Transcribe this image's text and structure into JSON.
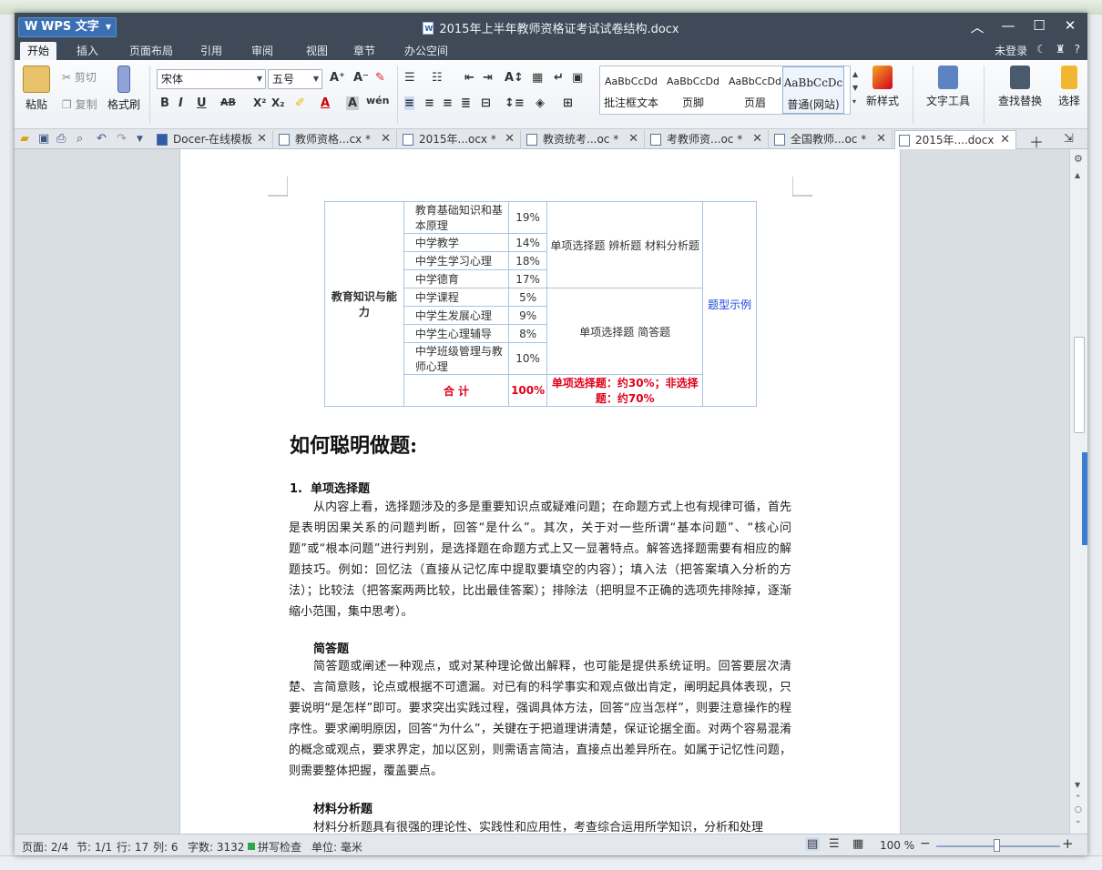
{
  "app": {
    "logo_text": "WPS 文字",
    "doc_title": "2015年上半年教师资格证考试试卷结构.docx"
  },
  "menu": {
    "tabs": [
      "开始",
      "插入",
      "页面布局",
      "引用",
      "审阅",
      "视图",
      "章节",
      "办公空间"
    ],
    "active": "开始",
    "login": "未登录",
    "help": "?"
  },
  "ribbon": {
    "paste": "粘贴",
    "cut": "剪切",
    "copy": "复制",
    "format_painter": "格式刷",
    "font": "宋体",
    "size": "五号",
    "styles": [
      {
        "preview": "AaBbCcDd",
        "name": "批注框文本"
      },
      {
        "preview": "AaBbCcDd",
        "name": "页脚"
      },
      {
        "preview": "AaBbCcDd",
        "name": "页眉"
      },
      {
        "preview": "AaBbCcDc",
        "name": "普通(网站)"
      }
    ],
    "new_style": "新样式",
    "text_tools": "文字工具",
    "find_replace": "查找替换",
    "select": "选择"
  },
  "doc_tabs": [
    {
      "label": "Docer-在线模板"
    },
    {
      "label": "教师资格...cx *"
    },
    {
      "label": "2015年...ocx *"
    },
    {
      "label": "教资统考...oc *"
    },
    {
      "label": "考教师资...oc *"
    },
    {
      "label": "全国教师...oc *"
    },
    {
      "label": "2015年....docx"
    }
  ],
  "table": {
    "category": "教育知识与能力",
    "rows": [
      {
        "subject": "教育基础知识和基本原理",
        "pct": "19%"
      },
      {
        "subject": "中学教学",
        "pct": "14%"
      },
      {
        "subject": "中学生学习心理",
        "pct": "18%"
      },
      {
        "subject": "中学德育",
        "pct": "17%"
      },
      {
        "subject": "中学课程",
        "pct": "5%"
      },
      {
        "subject": "中学生发展心理",
        "pct": "9%"
      },
      {
        "subject": "中学生心理辅导",
        "pct": "8%"
      },
      {
        "subject": "中学班级管理与教师心理",
        "pct": "10%"
      }
    ],
    "types_group1": "单项选择题 辨析题 材料分析题",
    "types_group2": "单项选择题 简答题",
    "example_link": "题型示例",
    "total_label": "合 计",
    "total_pct": "100%",
    "total_types": "单项选择题：约30%；非选择题：约70%"
  },
  "content": {
    "heading": "如何聪明做题:",
    "sec1_num": "1.",
    "sec1_title": "单项选择题",
    "sec1_text": "从内容上看，选择题涉及的多是重要知识点或疑难问题；在命题方式上也有规律可循，首先是表明因果关系的问题判断，回答“是什么”。其次，关于对一些所谓“基本问题”、“核心问题”或“根本问题”进行判别，是选择题在命题方式上又一显著特点。解答选择题需要有相应的解题技巧。例如：回忆法（直接从记忆库中提取要填空的内容）；填入法（把答案填入分析的方法）；比较法（把答案两两比较，比出最佳答案）；排除法（把明显不正确的选项先排除掉，逐渐缩小范围，集中思考）。",
    "sec2_title": "简答题",
    "sec2_text": "简答题或阐述一种观点，或对某种理论做出解释，也可能是提供系统证明。回答要层次清楚、言简意赅，论点或根据不可遗漏。对已有的科学事实和观点做出肯定，阐明起具体表现，只要说明“是怎样”即可。要求突出实践过程，强调具体方法，回答“应当怎样”，则要注意操作的程序性。要求阐明原因，回答“为什么”，关键在于把道理讲清楚，保证论据全面。对两个容易混淆的概念或观点，要求界定，加以区别，则需语言简洁，直接点出差异所在。如属于记忆性问题，则需要整体把握，覆盖要点。",
    "sec3_title": "材料分析题",
    "sec3_text": "材料分析题具有很强的理论性、实践性和应用性，考查综合运用所学知识，分析和处理"
  },
  "status": {
    "page": "页面: 2/4",
    "section": "节: 1/1",
    "line": "行: 17",
    "col": "列: 6",
    "words": "字数: 3132",
    "spell": "拼写检查",
    "unit": "单位: 毫米",
    "zoom": "100 %"
  }
}
